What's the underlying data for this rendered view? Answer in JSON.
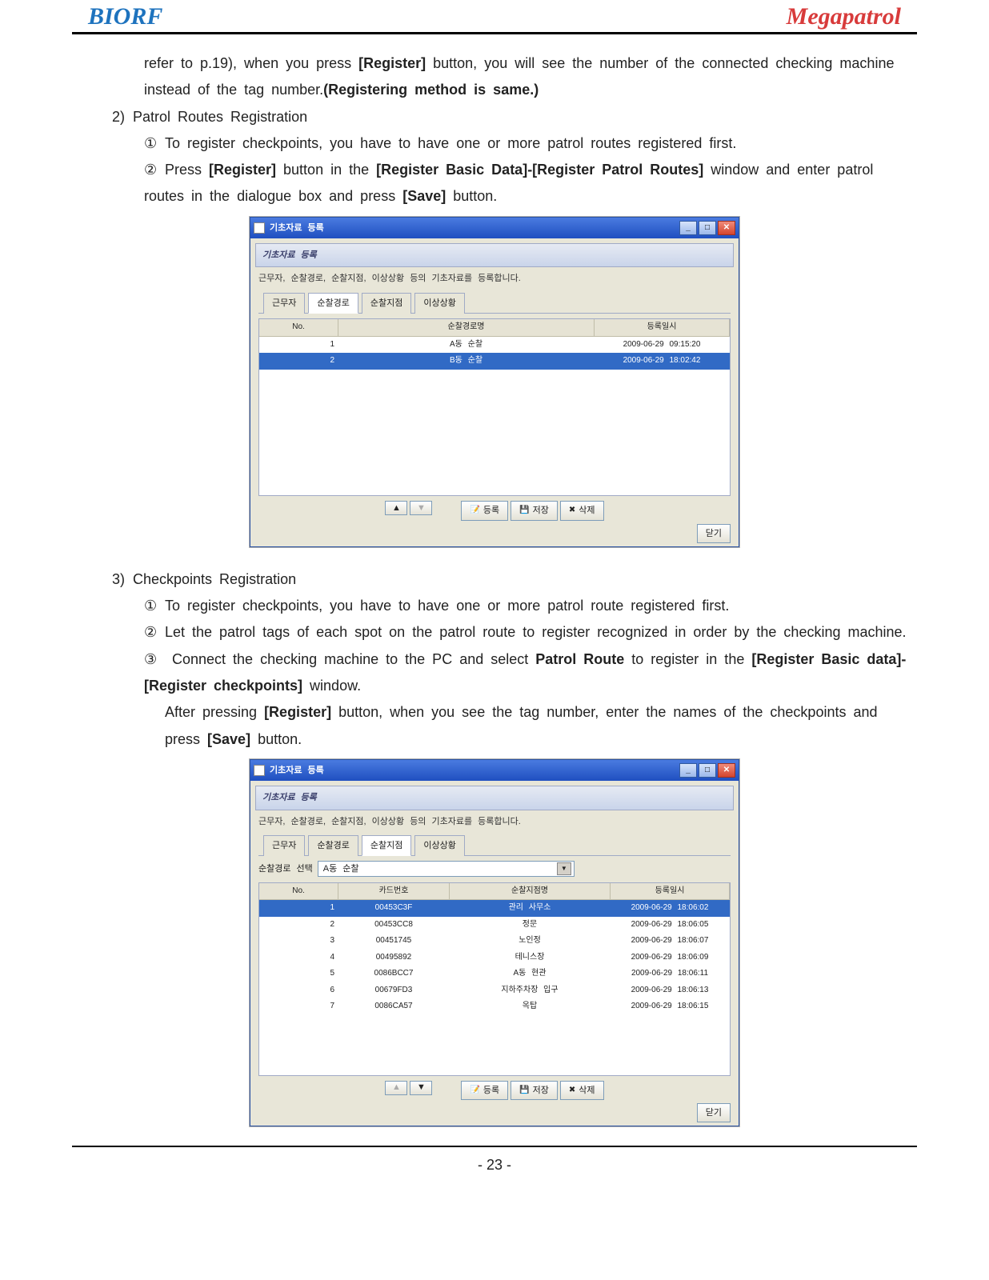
{
  "header": {
    "left": "BIORF",
    "right": "Megapatrol"
  },
  "body": {
    "p0_a": "refer to p.19), when you press ",
    "p0_b": "[Register]",
    "p0_c": " button, you will see the number of the connected checking machine instead of the tag number.",
    "p0_d": "(Registering method is same.)",
    "s2_num": "2)",
    "s2_title": "Patrol Routes Registration",
    "s2_i1_circ": "①",
    "s2_i1": "To register checkpoints, you have to have one or more patrol routes registered first.",
    "s2_i2_circ": "②",
    "s2_i2_a": "Press ",
    "s2_i2_b": "[Register]",
    "s2_i2_c": " button in the ",
    "s2_i2_d": "[Register Basic Data]-[Register Patrol Routes]",
    "s2_i2_e": " window and enter patrol routes in the dialogue box and press ",
    "s2_i2_f": "[Save]",
    "s2_i2_g": " button.",
    "s3_num": "3)",
    "s3_title": "Checkpoints Registration",
    "s3_i1_circ": "①",
    "s3_i1": "To register checkpoints, you have to have one or more patrol route registered first.",
    "s3_i2_circ": "②",
    "s3_i2": "Let the patrol tags of each spot on the patrol route to register recognized in order by the checking machine.",
    "s3_i3_circ": "③",
    "s3_i3_a": " Connect the checking machine to the PC and select ",
    "s3_i3_b": "Patrol Route",
    "s3_i3_c": " to register in the ",
    "s3_i3_d": "[Register Basic data]-[Register checkpoints]",
    "s3_i3_e": " window.",
    "s3_i3_f": "After pressing ",
    "s3_i3_g": "[Register]",
    "s3_i3_h": " button, when you see the tag number, enter the names of the checkpoints and press ",
    "s3_i3_i": "[Save]",
    "s3_i3_j": " button."
  },
  "win1": {
    "title": "기초자료 등록",
    "panel": "기초자료 등록",
    "sub": "근무자, 순찰경로, 순찰지점, 이상상황 등의 기초자료를 등록합니다.",
    "tabs": [
      "근무자",
      "순찰경로",
      "순찰지점",
      "이상상황"
    ],
    "activeTab": 1,
    "cols": [
      "No.",
      "순찰경로명",
      "등록일시"
    ],
    "rows": [
      {
        "no": "1",
        "name": "A동 순찰",
        "date": "2009-06-29 09:15:20"
      },
      {
        "no": "2",
        "name": "B동 순찰",
        "date": "2009-06-29 18:02:42"
      }
    ],
    "btn_up": "▲",
    "btn_down": "▼",
    "btn_reg": "등록",
    "btn_save": "저장",
    "btn_del": "삭제",
    "btn_close": "닫기"
  },
  "win2": {
    "title": "기초자료 등록",
    "panel": "기초자료 등록",
    "sub": "근무자, 순찰경로, 순찰지점, 이상상황 등의 기초자료를 등록합니다.",
    "tabs": [
      "근무자",
      "순찰경로",
      "순찰지점",
      "이상상황"
    ],
    "activeTab": 2,
    "routeLabel": "순찰경로 선택",
    "routeValue": "A동 순찰",
    "cols": [
      "No.",
      "카드번호",
      "순찰지점명",
      "등록일시"
    ],
    "rows": [
      {
        "no": "1",
        "card": "00453C3F",
        "spot": "관리 사무소",
        "date": "2009-06-29 18:06:02"
      },
      {
        "no": "2",
        "card": "00453CC8",
        "spot": "정문",
        "date": "2009-06-29 18:06:05"
      },
      {
        "no": "3",
        "card": "00451745",
        "spot": "노인정",
        "date": "2009-06-29 18:06:07"
      },
      {
        "no": "4",
        "card": "00495892",
        "spot": "테니스장",
        "date": "2009-06-29 18:06:09"
      },
      {
        "no": "5",
        "card": "0086BCC7",
        "spot": "A동 현관",
        "date": "2009-06-29 18:06:11"
      },
      {
        "no": "6",
        "card": "00679FD3",
        "spot": "지하주차장 입구",
        "date": "2009-06-29 18:06:13"
      },
      {
        "no": "7",
        "card": "0086CA57",
        "spot": "옥탑",
        "date": "2009-06-29 18:06:15"
      }
    ],
    "btn_up": "▲",
    "btn_down": "▼",
    "btn_reg": "등록",
    "btn_save": "저장",
    "btn_del": "삭제",
    "btn_close": "닫기"
  },
  "footer": {
    "page": "- 23 -"
  }
}
